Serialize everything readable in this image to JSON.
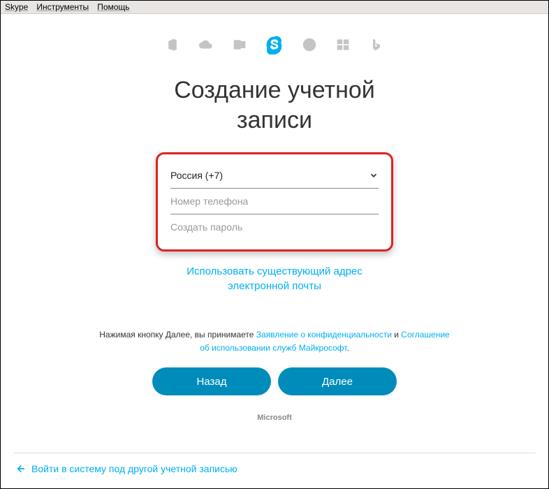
{
  "menubar": {
    "items": [
      "Skype",
      "Инструменты",
      "Помощь"
    ]
  },
  "title_line1": "Создание учетной",
  "title_line2": "записи",
  "form": {
    "country_select": "Россия (+7)",
    "phone_placeholder": "Номер телефона",
    "password_placeholder": "Создать пароль"
  },
  "use_email_line1": "Использовать существующий адрес",
  "use_email_line2": "электронной почты",
  "terms": {
    "prefix": "Нажимая кнопку ",
    "dalee": "Далее",
    "mid": ", вы принимаете ",
    "privacy": "Заявление о конфиденциальности",
    "and": " и ",
    "tos": "Соглашение об использовании служб Майкрософт",
    "suffix": "."
  },
  "buttons": {
    "back": "Назад",
    "next": "Далее"
  },
  "footer_brand": "Microsoft",
  "bottom_link": "Войти в систему под другой учетной записью"
}
